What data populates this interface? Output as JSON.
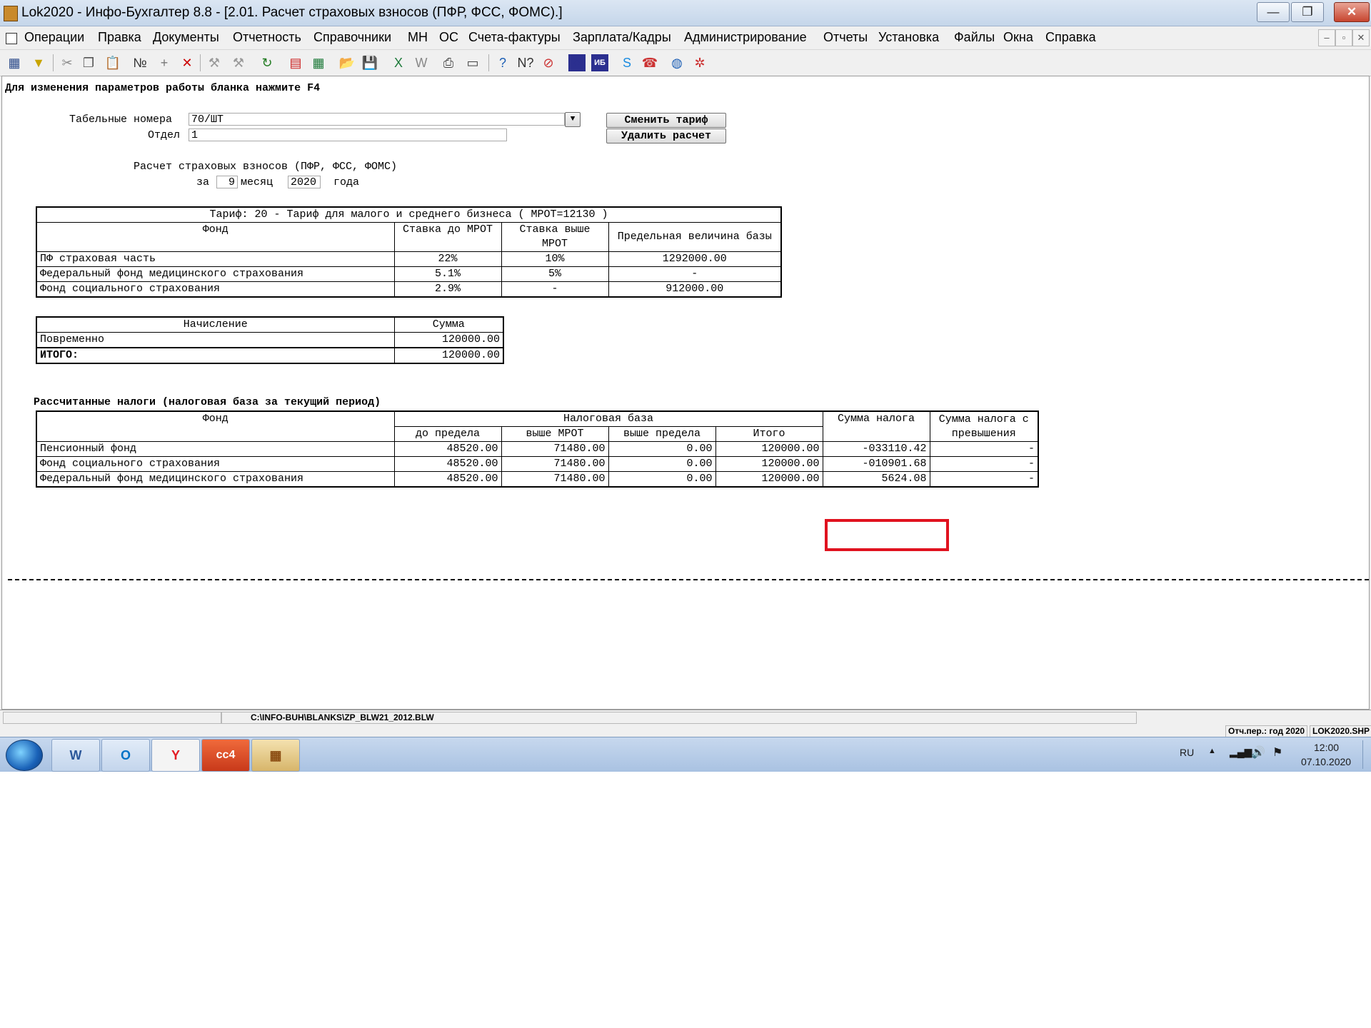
{
  "window": {
    "title": "Lok2020 - Инфо-Бухгалтер 8.8 - [2.01.   Расчет страховых взносов (ПФР, ФСС, ФОМС).]",
    "minimize": "—",
    "maximize": "❐",
    "close": "✕"
  },
  "menu": [
    "Операции",
    "Правка",
    "Документы",
    "Отчетность",
    "Справочники",
    "МН",
    "ОС",
    "Счета-фактуры",
    "Зарплата/Кадры",
    "Администрирование",
    "Отчеты",
    "Установка",
    "Файлы",
    "Окна",
    "Справка"
  ],
  "mdi": {
    "minimize": "–",
    "restore": "▫",
    "close": "✕"
  },
  "toolbar": {
    "icons": [
      {
        "name": "list-view-icon",
        "glyph": "▦",
        "color": "#2b4a8a"
      },
      {
        "name": "filter-icon",
        "glyph": "▼",
        "color": "#c8a400"
      },
      {
        "name": "cut-icon",
        "glyph": "✂",
        "color": "#888888"
      },
      {
        "name": "copy-icon",
        "glyph": "❐",
        "color": "#555555"
      },
      {
        "name": "paste-icon",
        "glyph": "📋",
        "color": "#555555"
      },
      {
        "name": "numbering-icon",
        "glyph": "№",
        "color": "#333333"
      },
      {
        "name": "add-icon",
        "glyph": "+",
        "color": "#777777"
      },
      {
        "name": "delete-icon",
        "glyph": "✕",
        "color": "#cc0000"
      },
      {
        "name": "tool-a-icon",
        "glyph": "⚒",
        "color": "#999999"
      },
      {
        "name": "tool-b-icon",
        "glyph": "⚒",
        "color": "#999999"
      },
      {
        "name": "refresh-icon",
        "glyph": "↻",
        "color": "#1f7a1f"
      },
      {
        "name": "calendar-icon",
        "glyph": "▤",
        "color": "#cc2222"
      },
      {
        "name": "calculator-icon",
        "glyph": "▦",
        "color": "#1e7a3a"
      },
      {
        "name": "open-folder-icon",
        "glyph": "📂",
        "color": "#c89000"
      },
      {
        "name": "save-icon",
        "glyph": "💾",
        "color": "#1d3f8f"
      },
      {
        "name": "excel-icon",
        "glyph": "X",
        "color": "#1e7a3a"
      },
      {
        "name": "word-icon",
        "glyph": "W",
        "color": "#888888"
      },
      {
        "name": "print-icon",
        "glyph": "⎙",
        "color": "#444444"
      },
      {
        "name": "print-preview-icon",
        "glyph": "▭",
        "color": "#444444"
      },
      {
        "name": "help-icon",
        "glyph": "?",
        "color": "#1d5fb5"
      },
      {
        "name": "context-help-icon",
        "glyph": "N?",
        "color": "#333333"
      },
      {
        "name": "compass-icon",
        "glyph": "⊘",
        "color": "#cc3333"
      },
      {
        "name": "info-book-icon",
        "glyph": "◆",
        "color": "#2b2f8f"
      },
      {
        "name": "ib10-icon",
        "glyph": "ИБ",
        "color": "#ffffff"
      },
      {
        "name": "skype-icon",
        "glyph": "S",
        "color": "#1a8be0"
      },
      {
        "name": "support-icon",
        "glyph": "☎",
        "color": "#cc3333"
      },
      {
        "name": "globe-icon",
        "glyph": "◍",
        "color": "#1d5fb5"
      },
      {
        "name": "network-icon",
        "glyph": "✲",
        "color": "#cc3333"
      }
    ]
  },
  "form": {
    "hint": "Для изменения параметров работы бланка нажмите F4",
    "tabel_label": "Табельные номера",
    "tabel_value": "70/ШТ",
    "dept_label": "Отдел",
    "dept_value": "1",
    "change_tariff_button": "Сменить тариф",
    "delete_calc_button": "Удалить расчет",
    "calc_title": "Расчет страховых взносов (ПФР, ФСС, ФОМС)",
    "period_prefix": "за",
    "month": "9",
    "month_label": "месяц",
    "year": "2020",
    "year_label": "года"
  },
  "tariff_table": {
    "title": "Тариф: 20 - Тариф для малого и среднего бизнеса  ( МРОТ=12130 )",
    "headers": [
      "Фонд",
      "Ставка до МРОТ",
      "Ставка выше МРОТ",
      "Предельная величина базы"
    ],
    "rows": [
      [
        "ПФ страховая часть",
        "22%",
        "10%",
        "1292000.00"
      ],
      [
        "Федеральный фонд медицинского страхования",
        "5.1%",
        "5%",
        "-"
      ],
      [
        "Фонд социального страхования",
        "2.9%",
        "-",
        "912000.00"
      ]
    ]
  },
  "accrual_table": {
    "headers": [
      "Начисление",
      "Сумма"
    ],
    "rows": [
      [
        "Повременно",
        "120000.00"
      ]
    ],
    "total": [
      "ИТОГО:",
      "120000.00"
    ]
  },
  "taxes": {
    "title": "Рассчитанные налоги (налоговая база за текущий период)",
    "header_fund": "Фонд",
    "header_base": "Налоговая база",
    "header_sum": "Сумма налога",
    "header_excess": "Сумма налога с превышения",
    "sub_headers": [
      "до предела",
      "выше МРОТ",
      "выше предела",
      "Итого"
    ],
    "rows": [
      [
        "Пенсионный фонд",
        "48520.00",
        "71480.00",
        "0.00",
        "120000.00",
        "-033110.42",
        "-"
      ],
      [
        "Фонд социального страхования",
        "48520.00",
        "71480.00",
        "0.00",
        "120000.00",
        "-010901.68",
        "-"
      ],
      [
        "Федеральный фонд медицинского страхования",
        "48520.00",
        "71480.00",
        "0.00",
        "120000.00",
        "5624.08",
        "-"
      ]
    ]
  },
  "status": {
    "path": "C:\\INFO-BUH\\BLANKS\\ZP_BLW21_2012.BLW",
    "period": "Отч.пер.: год 2020",
    "file": "LOK2020.SHP"
  },
  "taskbar": {
    "apps": [
      {
        "name": "word-app-icon",
        "glyph": "W",
        "color": "#2b579a"
      },
      {
        "name": "outlook-app-icon",
        "glyph": "O",
        "color": "#0072c6"
      },
      {
        "name": "yandex-app-icon",
        "glyph": "Y",
        "color": "#e31b23"
      },
      {
        "name": "cc4-app-icon",
        "glyph": "cc4",
        "color": "#ffffff"
      },
      {
        "name": "abacus-app-icon",
        "glyph": "▦",
        "color": "#8a4b10"
      }
    ],
    "lang": "RU",
    "time": "12:00",
    "date": "07.10.2020"
  },
  "colors": {
    "highlight": "#e0121f",
    "titlebar": "#c5d6ea"
  }
}
